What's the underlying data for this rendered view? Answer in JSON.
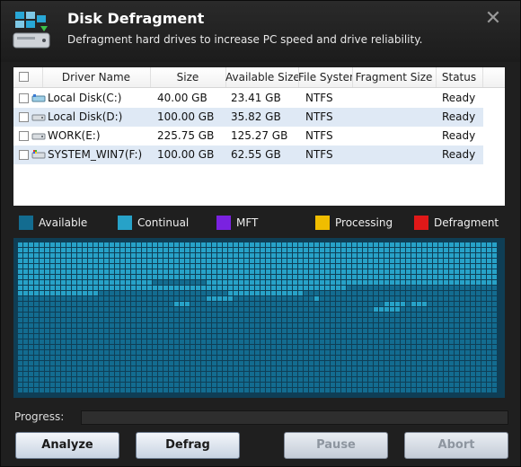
{
  "window": {
    "title": "Disk Defragment",
    "subtitle": "Defragment hard drives to increase PC speed and drive reliability.",
    "close_glyph": "✕"
  },
  "table": {
    "columns": [
      "Driver Name",
      "Size",
      "Available Size",
      "File System",
      "Fragment Size",
      "Status"
    ],
    "rows": [
      {
        "name": "Local Disk(C:)",
        "size": "40.00 GB",
        "available": "23.41 GB",
        "fs": "NTFS",
        "fragment": "",
        "status": "Ready",
        "icon": "system-drive-icon"
      },
      {
        "name": "Local Disk(D:)",
        "size": "100.00 GB",
        "available": "35.82 GB",
        "fs": "NTFS",
        "fragment": "",
        "status": "Ready",
        "icon": "hard-drive-icon"
      },
      {
        "name": "WORK(E:)",
        "size": "225.75 GB",
        "available": "125.27 GB",
        "fs": "NTFS",
        "fragment": "",
        "status": "Ready",
        "icon": "hard-drive-icon"
      },
      {
        "name": "SYSTEM_WIN7(F:)",
        "size": "100.00 GB",
        "available": "62.55 GB",
        "fs": "NTFS",
        "fragment": "",
        "status": "Ready",
        "icon": "windows-drive-icon"
      }
    ]
  },
  "legend": [
    {
      "label": "Available",
      "color": "#136c90"
    },
    {
      "label": "Continual",
      "color": "#27a2c8"
    },
    {
      "label": "MFT",
      "color": "#7a22e0"
    },
    {
      "label": "Processing",
      "color": "#f0bd00"
    },
    {
      "label": "Defragment",
      "color": "#e01818"
    }
  ],
  "cluster_map": {
    "available_color": "#136c90",
    "continual_color": "#27a2c8"
  },
  "progress": {
    "label": "Progress:",
    "value": 0
  },
  "buttons": {
    "analyze": "Analyze",
    "defrag": "Defrag",
    "pause": "Pause",
    "abort": "Abort"
  }
}
